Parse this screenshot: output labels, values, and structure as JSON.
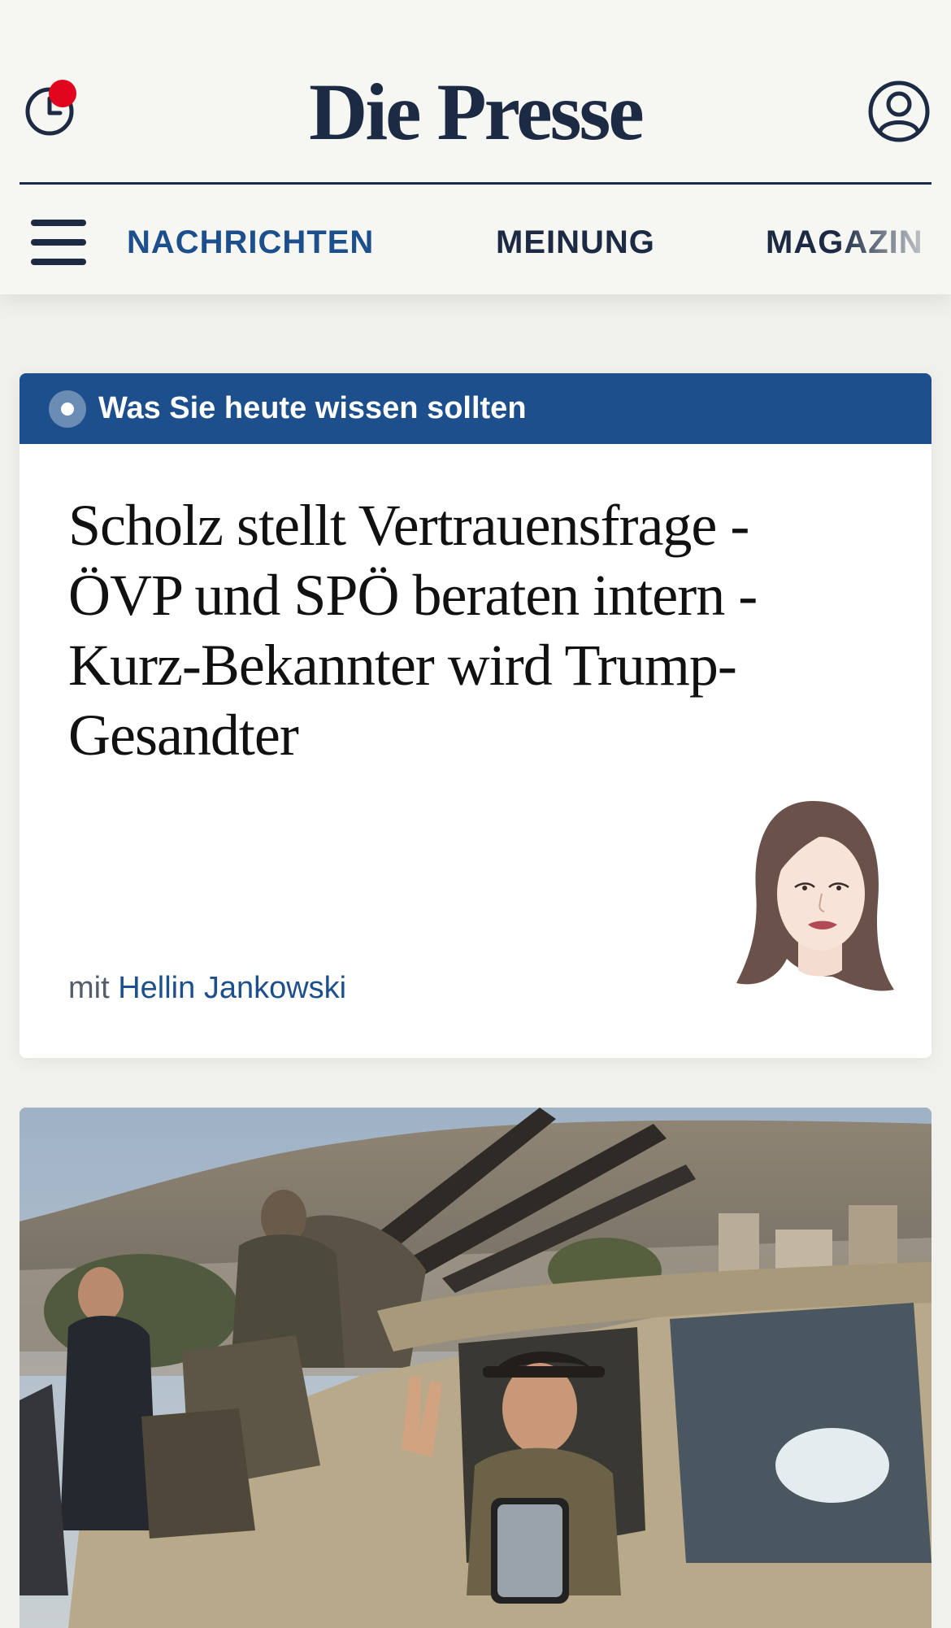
{
  "header": {
    "logo": "Die Presse",
    "history_icon": "clock-icon",
    "account_icon": "user-icon",
    "menu_icon": "hamburger-icon",
    "notification_color": "#e0061d",
    "brand_color": "#1c2a44"
  },
  "nav": {
    "items": [
      {
        "label": "NACHRICHTEN",
        "active": true
      },
      {
        "label": "MEINUNG",
        "active": false
      },
      {
        "label": "MAGAZIN",
        "active": false
      }
    ],
    "active_color": "#1c4f8c"
  },
  "featured": {
    "banner_label": "Was Sie heute wissen sollten",
    "banner_color": "#1c4f8c",
    "title": "Scholz stellt Vertrauensfrage - ÖVP und SPÖ beraten intern - Kurz-Bekannter wird Trump-Gesandter",
    "byline_prefix": "mit",
    "author": "Hellin Jankowski",
    "author_avatar": "author-portrait-illustration"
  },
  "photo_story": {
    "image": "news-photo-armed-pickup-truck"
  }
}
